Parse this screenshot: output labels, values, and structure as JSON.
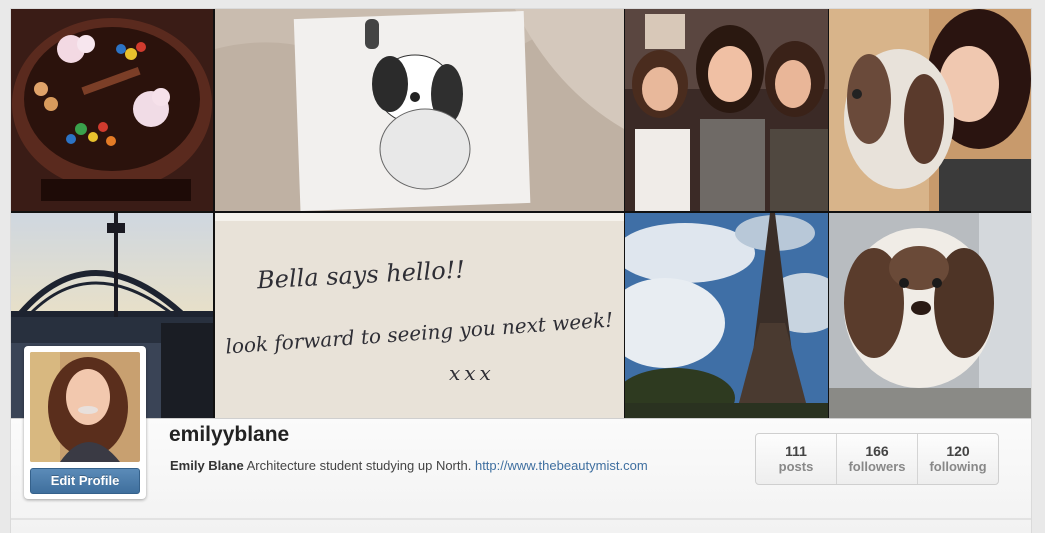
{
  "profile": {
    "username": "emilyyblane",
    "full_name": "Emily Blane",
    "bio": "Architecture student studying up North.",
    "website": "http://www.thebeautymist.com",
    "edit_button_label": "Edit Profile"
  },
  "stats": [
    {
      "count": "111",
      "label": "posts"
    },
    {
      "count": "166",
      "label": "followers"
    },
    {
      "count": "120",
      "label": "following"
    }
  ],
  "photo_grid": {
    "note_text": {
      "line1": "Bella says hello!!",
      "line2": "look forward to seeing you next week!",
      "line3": "xxx"
    }
  },
  "colors": {
    "edit_button": "#4a7aa8",
    "link": "#3f6fa0",
    "stats_border": "#cfcfcf"
  }
}
